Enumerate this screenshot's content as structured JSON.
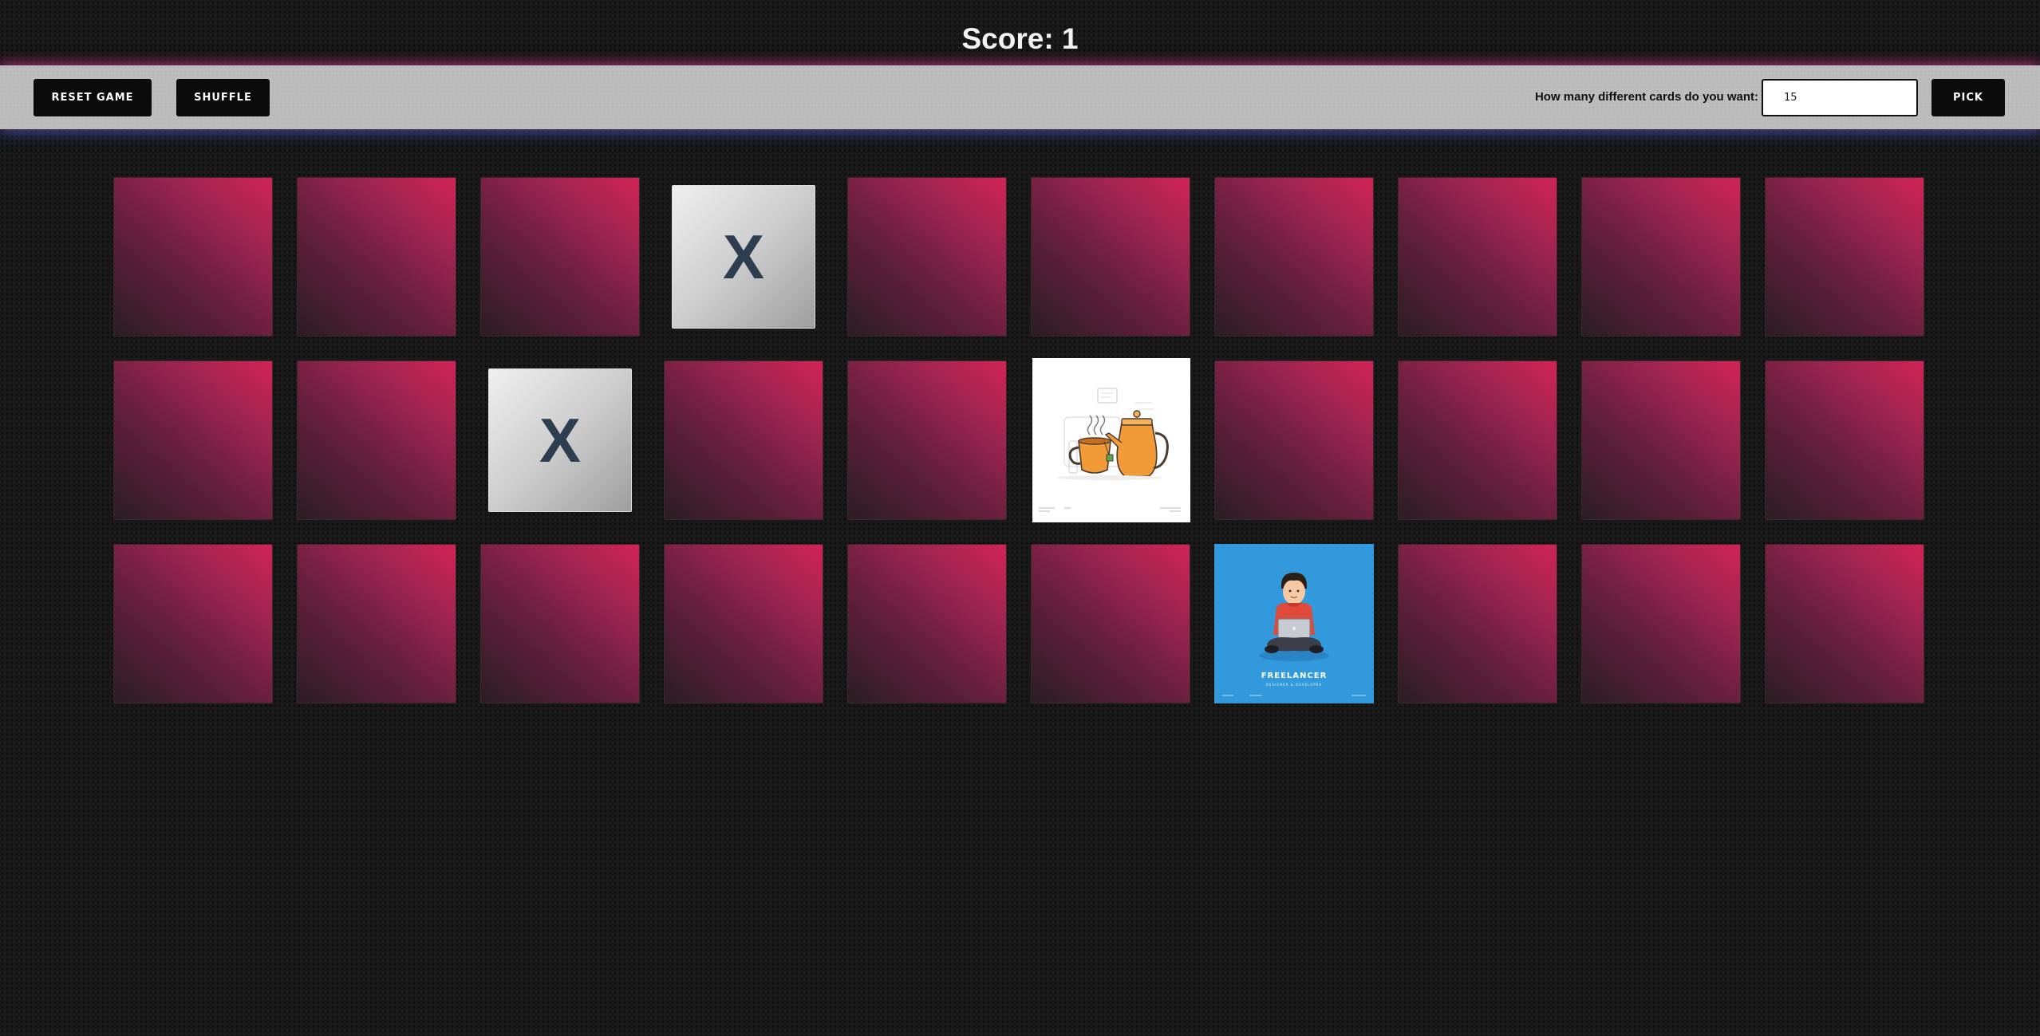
{
  "score": {
    "label": "Score: 1"
  },
  "toolbar": {
    "reset_label": "Reset Game",
    "shuffle_label": "Shuffle",
    "pick_prompt": "How many different cards do you want:",
    "pick_value": "15",
    "pick_label": "Pick"
  },
  "colors": {
    "card_back_light": "#d22356",
    "card_back_dark": "#2b1d23",
    "matched_mark": "#2c3e50",
    "toolbar_bg": "#bdbdbd",
    "button_bg": "#0b0b0b"
  },
  "board": {
    "rows": 3,
    "columns": 10,
    "cards": [
      {
        "state": "hidden"
      },
      {
        "state": "hidden"
      },
      {
        "state": "hidden"
      },
      {
        "state": "matched",
        "mark": "X"
      },
      {
        "state": "hidden"
      },
      {
        "state": "hidden"
      },
      {
        "state": "hidden"
      },
      {
        "state": "hidden"
      },
      {
        "state": "hidden"
      },
      {
        "state": "hidden"
      },
      {
        "state": "hidden"
      },
      {
        "state": "hidden"
      },
      {
        "state": "matched",
        "mark": "X"
      },
      {
        "state": "hidden"
      },
      {
        "state": "hidden"
      },
      {
        "state": "revealed",
        "image": "tea-kettle-illustration"
      },
      {
        "state": "hidden"
      },
      {
        "state": "hidden"
      },
      {
        "state": "hidden"
      },
      {
        "state": "hidden"
      },
      {
        "state": "hidden"
      },
      {
        "state": "hidden"
      },
      {
        "state": "hidden"
      },
      {
        "state": "hidden"
      },
      {
        "state": "hidden"
      },
      {
        "state": "hidden"
      },
      {
        "state": "revealed",
        "image": "freelancer-illustration",
        "caption": "FREELANCER",
        "subcaption": "DESIGNER & DEVELOPER"
      },
      {
        "state": "hidden"
      },
      {
        "state": "hidden"
      },
      {
        "state": "hidden"
      }
    ]
  }
}
